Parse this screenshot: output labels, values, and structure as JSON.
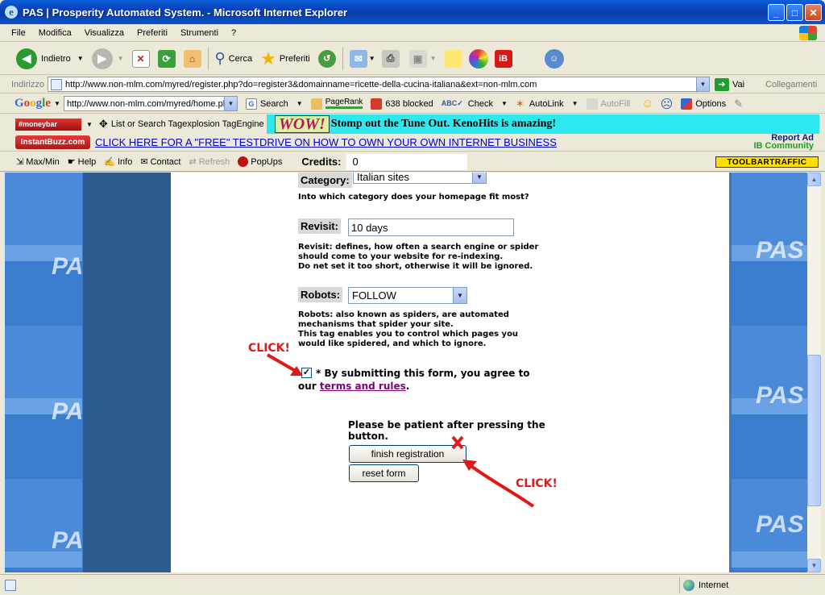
{
  "window": {
    "title": "PAS | Prosperity Automated System. - Microsoft Internet Explorer"
  },
  "menu": [
    "File",
    "Modifica",
    "Visualizza",
    "Preferiti",
    "Strumenti",
    "?"
  ],
  "toolbar": {
    "back": "Indietro",
    "search": "Cerca",
    "favorites": "Preferiti"
  },
  "address": {
    "label": "Indirizzo",
    "url": "http://www.non-mlm.com/myred/register.php?do=register3&domainname=ricette-della-cucina-italiana&ext=non-mlm.com",
    "go": "Vai",
    "links": "Collegamenti"
  },
  "google": {
    "logo": "Google",
    "url": "http://www.non-mlm.com/myred/home.php",
    "search": "Search",
    "pagerank": "PageRank",
    "blocked": "638 blocked",
    "check": "Check",
    "autolink": "AutoLink",
    "autofill": "AutoFill",
    "options": "Options"
  },
  "tagbar": {
    "brand": "#moneybar",
    "list": "List or Search Tagexplosion TagEngine",
    "wow": "WOW!",
    "ad_text": "Stomp out the Tune Out. KenoHits is amazing!"
  },
  "ibbar": {
    "brand": "InstantBuzz.com",
    "link": "CLICK HERE FOR A \"FREE\" TESTDRIVE ON HOW TO OWN YOUR OWN INTERNET BUSINESS",
    "report": "Report Ad",
    "community": "IB Community"
  },
  "trafficbar": {
    "maxmin": "Max/Min",
    "help": "Help",
    "info": "Info",
    "contact": "Contact",
    "refresh": "Refresh",
    "popups": "PopUps",
    "credits_label": "Credits:",
    "credits_value": "0",
    "brand": "TOOLBARTRAFFIC"
  },
  "watermark": "PAS",
  "form": {
    "category": {
      "label": "Category:",
      "selected": "Italian sites",
      "help": "Into which category does your homepage fit most?"
    },
    "revisit": {
      "label": "Revisit:",
      "value": "10 days",
      "help1": "Revisit: defines, how often a search engine or spider",
      "help2": "should come to your website for re-indexing.",
      "help3": "Do net set it too short, otherwise it will be ignored."
    },
    "robots": {
      "label": "Robots:",
      "selected": "FOLLOW",
      "help1": "Robots: also known as spiders, are automated",
      "help2": "mechanisms that spider your site.",
      "help3": "This tag enables you to control which pages you",
      "help4": "would like spidered, and which to ignore."
    },
    "agree": {
      "text1": "* By submitting this form, you agree to",
      "text2": "our",
      "link": "terms and rules",
      "end": "."
    },
    "patient1": "Please be patient after pressing the",
    "patient2": "button.",
    "finish": "finish registration",
    "reset": "reset form"
  },
  "annotations": {
    "click1": "CLICK!",
    "click2": "CLICK!"
  },
  "status": {
    "zone": "Internet"
  }
}
